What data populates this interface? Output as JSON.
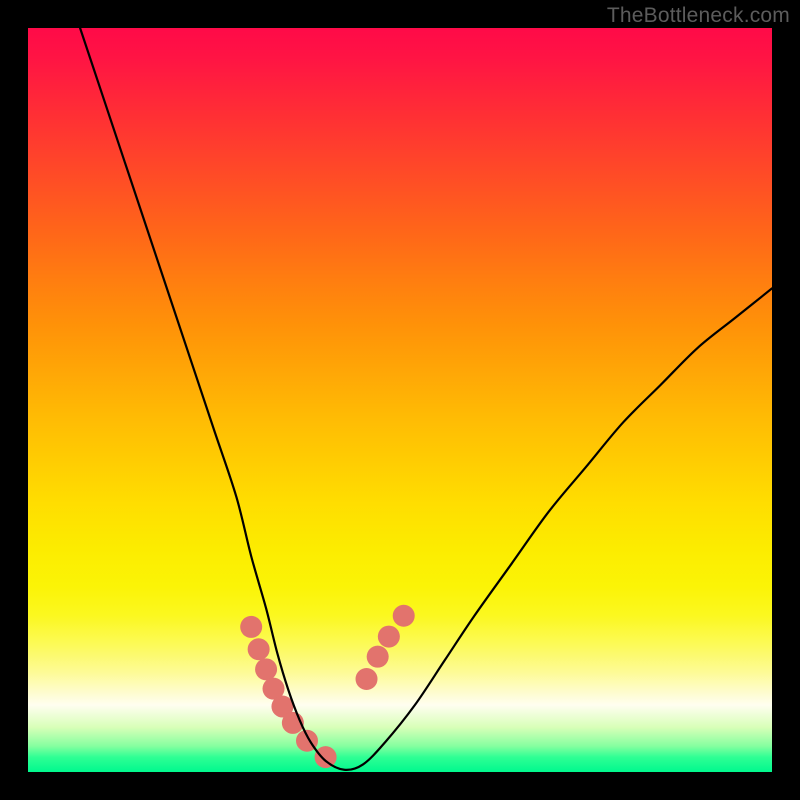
{
  "watermark": "TheBottleneck.com",
  "chart_data": {
    "type": "line",
    "title": "",
    "xlabel": "",
    "ylabel": "",
    "x_range": [
      0,
      100
    ],
    "y_range": [
      0,
      100
    ],
    "series": [
      {
        "name": "bottleneck-curve",
        "color": "#000000",
        "x": [
          7,
          10,
          13,
          16,
          19,
          22,
          25,
          28,
          30,
          32,
          33.5,
          35,
          36.5,
          38,
          40,
          42.5,
          45,
          48,
          52,
          56,
          60,
          65,
          70,
          75,
          80,
          85,
          90,
          95,
          100
        ],
        "y": [
          100,
          91,
          82,
          73,
          64,
          55,
          46,
          37,
          29,
          22,
          16,
          11,
          7,
          4,
          1.5,
          0.3,
          1.0,
          4,
          9,
          15,
          21,
          28,
          35,
          41,
          47,
          52,
          57,
          61,
          65
        ]
      },
      {
        "name": "highlight-dots-left",
        "color": "#e2736d",
        "x": [
          30.0,
          31.0,
          32.0,
          33.0,
          34.2,
          35.6,
          37.5,
          40.0
        ],
        "y": [
          19.5,
          16.5,
          13.8,
          11.2,
          8.8,
          6.6,
          4.2,
          2.0
        ]
      },
      {
        "name": "highlight-dots-right",
        "color": "#e2736d",
        "x": [
          45.5,
          47.0,
          48.5,
          50.5
        ],
        "y": [
          12.5,
          15.5,
          18.2,
          21.0
        ]
      }
    ],
    "background_gradient": {
      "type": "vertical",
      "stops": [
        {
          "pos": 0.0,
          "color": "#ff0a48"
        },
        {
          "pos": 0.35,
          "color": "#ff8a0c"
        },
        {
          "pos": 0.65,
          "color": "#ffe000"
        },
        {
          "pos": 0.88,
          "color": "#fffde0"
        },
        {
          "pos": 1.0,
          "color": "#00f88e"
        }
      ]
    }
  }
}
